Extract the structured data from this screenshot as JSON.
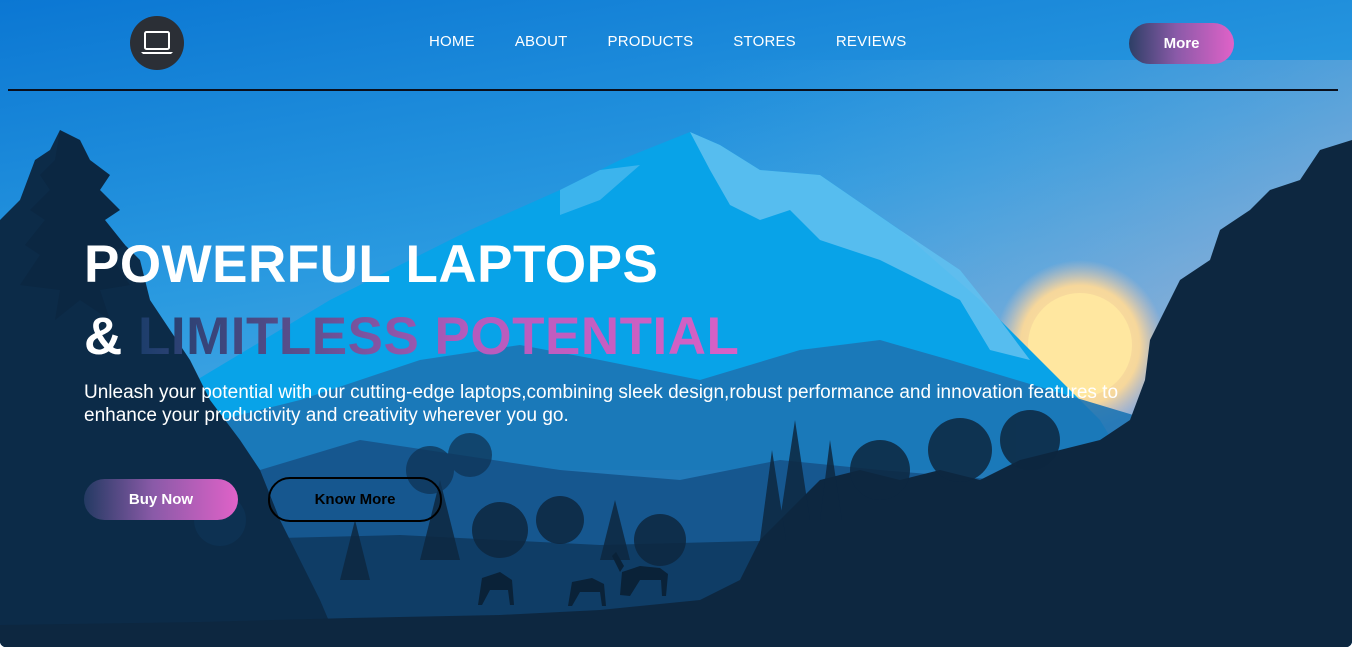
{
  "nav": {
    "logo_icon": "laptop-icon",
    "items": [
      {
        "label": "HOME"
      },
      {
        "label": "ABOUT"
      },
      {
        "label": "PRODUCTS"
      },
      {
        "label": "STORES"
      },
      {
        "label": "REVIEWS"
      }
    ],
    "more_label": "More"
  },
  "hero": {
    "title_line1": "POWERFUL LAPTOPS",
    "title_line2_amp": "&",
    "title_line2_rest": "LIMITLESS POTENTIAL",
    "subtitle": "Unleash your potential with our cutting-edge laptops,combining sleek design,robust performance and innovation features to enhance your productivity and creativity wherever you go.",
    "buy_label": "Buy Now",
    "know_label": "Know More"
  },
  "colors": {
    "sky_top": "#0a7fd6",
    "mountain": "#17a4e6",
    "forest": "#0d2740",
    "accent_pink": "#e062c8",
    "accent_navy": "#2d3f66"
  }
}
